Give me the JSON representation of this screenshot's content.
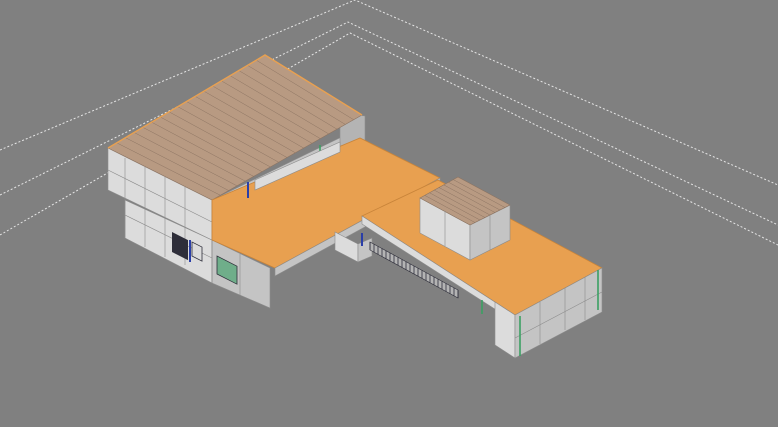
{
  "viewport": {
    "view": "isometric",
    "background_color": "#808080"
  },
  "colors": {
    "grid_dash": "#e6e6e6",
    "wall_light": "#dcdcdc",
    "wall_shadow": "#c4c4c4",
    "wall_dark": "#b4b4b4",
    "panel_line": "#8c8c8c",
    "floor": "#e8a050",
    "floor_edge": "#c8843a",
    "roof": "#b89a82",
    "roof_line": "#8c7462",
    "window_dark": "#2e2e3a",
    "window_glass": "#6fae8a",
    "accent_blue": "#2a3ea8",
    "accent_green": "#3aa062"
  },
  "model": {
    "type": "house-3d-model",
    "parts": [
      "main-block",
      "roof",
      "open-floor",
      "terrace-slab",
      "rooftop-box",
      "balustrade",
      "windows"
    ]
  }
}
